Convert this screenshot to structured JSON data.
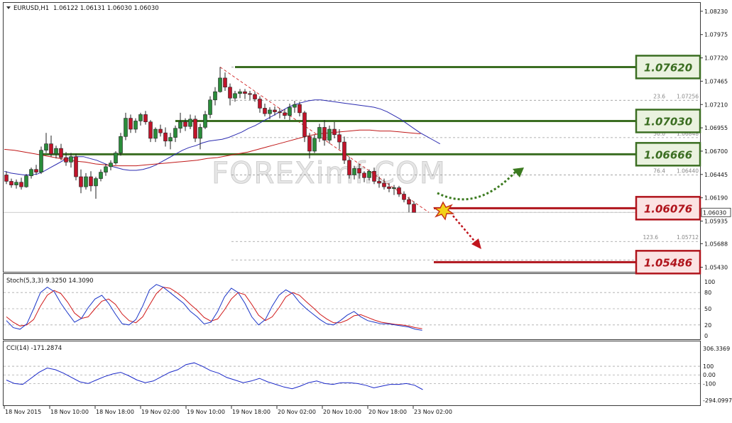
{
  "header": {
    "symbol": "EURUSD,H1",
    "ohlc": "1.06122 1.06131 1.06030 1.06030"
  },
  "watermark": "FOREXimf.COM",
  "price_axis": {
    "ticks": [
      "1.08230",
      "1.07975",
      "1.07720",
      "1.07465",
      "1.07210",
      "1.06955",
      "1.06700",
      "1.06445",
      "1.06190",
      "1.05935",
      "1.05688",
      "1.05430"
    ],
    "current_price": "1.06030"
  },
  "levels": [
    {
      "label": "1.07620",
      "price": 1.0762,
      "color": "#3b6e22",
      "box_bg": "#eaf2df",
      "from_index": 46
    },
    {
      "label": "1.07030",
      "price": 1.0703,
      "color": "#3b6e22",
      "box_bg": "#eaf2df",
      "from_index": 34
    },
    {
      "label": "1.06666",
      "price": 1.06666,
      "color": "#3b6e22",
      "box_bg": "#eaf2df",
      "from_index": 7
    },
    {
      "label": "1.06076",
      "price": 1.06076,
      "color": "#b0141c",
      "box_bg": "#fbe3e3",
      "from_index": 86
    },
    {
      "label": "1.05486",
      "price": 1.05486,
      "color": "#b0141c",
      "box_bg": "#fbe3e3",
      "from_index": 86
    }
  ],
  "fibo": [
    {
      "ratio": "23.6",
      "value": "1.07256",
      "price": 1.07256
    },
    {
      "ratio": "50.0",
      "value": "1.06848",
      "price": 1.06848
    },
    {
      "ratio": "76.4",
      "value": "1.06440",
      "price": 1.0644
    },
    {
      "ratio": "123.6",
      "value": "1.05712",
      "price": 1.05712
    }
  ],
  "stoch": {
    "label": "Stoch(5,3,3) 9.3250 14.3090",
    "ticks": [
      "100",
      "80",
      "50",
      "20",
      "0"
    ]
  },
  "cci": {
    "label": "CCI(14) -171.2874",
    "ticks": [
      "306.3369",
      "100",
      "0.00",
      "-100",
      "-294.0997"
    ]
  },
  "time_axis": {
    "ticks": [
      "18 Nov 2015",
      "18 Nov 10:00",
      "18 Nov 18:00",
      "19 Nov 02:00",
      "19 Nov 10:00",
      "19 Nov 18:00",
      "20 Nov 02:00",
      "20 Nov 10:00",
      "20 Nov 18:00",
      "23 Nov 02:00"
    ]
  },
  "colors": {
    "bull": "#2a8c3a",
    "bear": "#c0142a",
    "ma_fast": "#2b2bb0",
    "ma_slow": "#c01818",
    "stoch_main": "#1a35c8",
    "stoch_signal": "#d01818",
    "cci": "#1a28c8",
    "arrow_up": "#3b7a1f",
    "arrow_down": "#c0141c"
  },
  "chart_data": {
    "type": "candlestick",
    "symbol": "EURUSD",
    "timeframe": "H1",
    "ylim": [
      1.0538,
      1.0826
    ],
    "candles": [
      [
        1.0644,
        1.0648,
        1.0634,
        1.0637
      ],
      [
        1.0637,
        1.064,
        1.063,
        1.0633
      ],
      [
        1.0633,
        1.0639,
        1.0629,
        1.0636
      ],
      [
        1.0636,
        1.0641,
        1.0628,
        1.0631
      ],
      [
        1.0631,
        1.0645,
        1.063,
        1.0643
      ],
      [
        1.0643,
        1.0652,
        1.064,
        1.065
      ],
      [
        1.065,
        1.0655,
        1.0644,
        1.0647
      ],
      [
        1.0647,
        1.0675,
        1.0645,
        1.0671
      ],
      [
        1.0671,
        1.069,
        1.0668,
        1.0678
      ],
      [
        1.0678,
        1.0687,
        1.0664,
        1.0667
      ],
      [
        1.0667,
        1.0676,
        1.0662,
        1.0673
      ],
      [
        1.0673,
        1.0678,
        1.066,
        1.0663
      ],
      [
        1.0663,
        1.0669,
        1.0654,
        1.0658
      ],
      [
        1.0658,
        1.0668,
        1.0652,
        1.0664
      ],
      [
        1.0664,
        1.0667,
        1.0638,
        1.0642
      ],
      [
        1.0642,
        1.065,
        1.0624,
        1.0631
      ],
      [
        1.0631,
        1.0646,
        1.0628,
        1.0642
      ],
      [
        1.0642,
        1.0648,
        1.0626,
        1.0632
      ],
      [
        1.0632,
        1.0642,
        1.0618,
        1.064
      ],
      [
        1.064,
        1.065,
        1.0637,
        1.0647
      ],
      [
        1.0647,
        1.0656,
        1.0643,
        1.0653
      ],
      [
        1.0653,
        1.066,
        1.0649,
        1.0657
      ],
      [
        1.0657,
        1.067,
        1.0655,
        1.0668
      ],
      [
        1.0668,
        1.069,
        1.0665,
        1.0686
      ],
      [
        1.0686,
        1.0712,
        1.0682,
        1.0706
      ],
      [
        1.0706,
        1.071,
        1.069,
        1.0694
      ],
      [
        1.0694,
        1.0706,
        1.069,
        1.0703
      ],
      [
        1.0703,
        1.0712,
        1.0698,
        1.071
      ],
      [
        1.071,
        1.0714,
        1.0699,
        1.0702
      ],
      [
        1.0702,
        1.0704,
        1.068,
        1.0684
      ],
      [
        1.0684,
        1.0696,
        1.068,
        1.0694
      ],
      [
        1.0694,
        1.0699,
        1.0686,
        1.069
      ],
      [
        1.069,
        1.0696,
        1.0675,
        1.0681
      ],
      [
        1.0681,
        1.069,
        1.0672,
        1.0685
      ],
      [
        1.0685,
        1.0698,
        1.068,
        1.0695
      ],
      [
        1.0695,
        1.0712,
        1.069,
        1.0702
      ],
      [
        1.0702,
        1.0706,
        1.0692,
        1.0697
      ],
      [
        1.0697,
        1.071,
        1.0694,
        1.0705
      ],
      [
        1.0705,
        1.0709,
        1.068,
        1.0684
      ],
      [
        1.0684,
        1.07,
        1.0672,
        1.0696
      ],
      [
        1.0696,
        1.0714,
        1.0694,
        1.071
      ],
      [
        1.071,
        1.073,
        1.0706,
        1.0726
      ],
      [
        1.0726,
        1.074,
        1.072,
        1.0735
      ],
      [
        1.0735,
        1.0762,
        1.0734,
        1.075
      ],
      [
        1.075,
        1.0756,
        1.0736,
        1.074
      ],
      [
        1.074,
        1.0744,
        1.072,
        1.0728
      ],
      [
        1.0728,
        1.0736,
        1.0724,
        1.0733
      ],
      [
        1.0733,
        1.0738,
        1.0728,
        1.0735
      ],
      [
        1.0735,
        1.0738,
        1.0727,
        1.0733
      ],
      [
        1.0733,
        1.0736,
        1.0726,
        1.0732
      ],
      [
        1.0732,
        1.0735,
        1.0724,
        1.0727
      ],
      [
        1.0727,
        1.073,
        1.0712,
        1.0717
      ],
      [
        1.0717,
        1.0722,
        1.0708,
        1.0711
      ],
      [
        1.0711,
        1.0718,
        1.0705,
        1.0715
      ],
      [
        1.0715,
        1.0719,
        1.0709,
        1.0713
      ],
      [
        1.0713,
        1.0717,
        1.0706,
        1.0712
      ],
      [
        1.0712,
        1.0716,
        1.0705,
        1.0709
      ],
      [
        1.0709,
        1.0722,
        1.0704,
        1.0718
      ],
      [
        1.0718,
        1.0725,
        1.0712,
        1.0721
      ],
      [
        1.0721,
        1.0724,
        1.0708,
        1.0712
      ],
      [
        1.0712,
        1.0714,
        1.068,
        1.0686
      ],
      [
        1.0686,
        1.069,
        1.0662,
        1.067
      ],
      [
        1.067,
        1.0688,
        1.0668,
        1.0684
      ],
      [
        1.0684,
        1.07,
        1.068,
        1.0696
      ],
      [
        1.0696,
        1.0704,
        1.0676,
        1.0682
      ],
      [
        1.0682,
        1.0698,
        1.0678,
        1.0694
      ],
      [
        1.0694,
        1.0702,
        1.0684,
        1.0688
      ],
      [
        1.0688,
        1.0694,
        1.0672,
        1.068
      ],
      [
        1.068,
        1.0686,
        1.0656,
        1.066
      ],
      [
        1.066,
        1.0664,
        1.064,
        1.0644
      ],
      [
        1.0644,
        1.0654,
        1.0639,
        1.0651
      ],
      [
        1.0651,
        1.0656,
        1.064,
        1.0646
      ],
      [
        1.0646,
        1.0648,
        1.0636,
        1.0641
      ],
      [
        1.0641,
        1.065,
        1.0638,
        1.0648
      ],
      [
        1.0648,
        1.0652,
        1.0634,
        1.0637
      ],
      [
        1.0637,
        1.0642,
        1.063,
        1.0635
      ],
      [
        1.0635,
        1.064,
        1.0628,
        1.0631
      ],
      [
        1.0631,
        1.0635,
        1.0625,
        1.0629
      ],
      [
        1.0629,
        1.0633,
        1.0622,
        1.063
      ],
      [
        1.063,
        1.0632,
        1.062,
        1.0623
      ],
      [
        1.0623,
        1.0626,
        1.0614,
        1.0617
      ],
      [
        1.0617,
        1.062,
        1.0603,
        1.0612
      ],
      [
        1.0612,
        1.0615,
        1.0603,
        1.0603
      ]
    ],
    "ma_fast": [
      1.0648,
      1.0646,
      1.0645,
      1.0644,
      1.0644,
      1.0645,
      1.0648,
      1.0652,
      1.0656,
      1.066,
      1.0663,
      1.0664,
      1.0664,
      1.0662,
      1.066,
      1.0657,
      1.0654,
      1.0652,
      1.065,
      1.0649,
      1.0649,
      1.065,
      1.0652,
      1.0655,
      1.0659,
      1.0663,
      1.0667,
      1.0671,
      1.0674,
      1.0676,
      1.0679,
      1.0681,
      1.0682,
      1.0683,
      1.0685,
      1.0688,
      1.0691,
      1.0695,
      1.0698,
      1.0702,
      1.0706,
      1.071,
      1.0714,
      1.0718,
      1.0721,
      1.0723,
      1.0725,
      1.0726,
      1.0726,
      1.0725,
      1.0724,
      1.0723,
      1.0722,
      1.0721,
      1.072,
      1.0719,
      1.0718,
      1.0716,
      1.0713,
      1.0709,
      1.0705,
      1.07,
      1.0695,
      1.069,
      1.0686,
      1.0682,
      1.0678
    ],
    "ma_slow": [
      1.0672,
      1.0671,
      1.0669,
      1.0667,
      1.0665,
      1.0663,
      1.0661,
      1.0659,
      1.0658,
      1.0656,
      1.0655,
      1.0654,
      1.0654,
      1.0654,
      1.0655,
      1.0656,
      1.0657,
      1.0658,
      1.0659,
      1.066,
      1.0662,
      1.0663,
      1.0665,
      1.0667,
      1.0669,
      1.0672,
      1.0675,
      1.0678,
      1.0681,
      1.0684,
      1.0687,
      1.0689,
      1.069,
      1.0691,
      1.0692,
      1.0693,
      1.0693,
      1.0692,
      1.0692,
      1.0691,
      1.069,
      1.0689
    ],
    "stoch_main": [
      28,
      15,
      12,
      22,
      50,
      80,
      90,
      82,
      60,
      42,
      25,
      32,
      52,
      68,
      75,
      60,
      40,
      22,
      20,
      30,
      55,
      85,
      95,
      90,
      80,
      70,
      60,
      45,
      35,
      22,
      25,
      45,
      72,
      88,
      80,
      60,
      35,
      20,
      30,
      55,
      75,
      85,
      78,
      62,
      50,
      40,
      30,
      22,
      20,
      28,
      38,
      45,
      35,
      28,
      25,
      22,
      22,
      20,
      18,
      16,
      12,
      10
    ],
    "stoch_signal": [
      35,
      25,
      18,
      20,
      30,
      55,
      75,
      84,
      78,
      62,
      42,
      32,
      35,
      50,
      64,
      68,
      58,
      40,
      28,
      24,
      35,
      57,
      78,
      90,
      88,
      80,
      70,
      58,
      47,
      34,
      27,
      31,
      48,
      68,
      80,
      76,
      58,
      38,
      28,
      35,
      52,
      72,
      80,
      75,
      63,
      52,
      40,
      31,
      24,
      24,
      29,
      37,
      39,
      34,
      29,
      25,
      23,
      21,
      20,
      18,
      15,
      13
    ],
    "cci": [
      -60,
      -100,
      -110,
      -40,
      30,
      80,
      60,
      20,
      -30,
      -80,
      -100,
      -60,
      -20,
      10,
      30,
      -10,
      -60,
      -90,
      -70,
      -20,
      30,
      60,
      120,
      140,
      100,
      50,
      20,
      -30,
      -60,
      -90,
      -70,
      -40,
      -80,
      -110,
      -140,
      -160,
      -130,
      -90,
      -70,
      -100,
      -110,
      -90,
      -90,
      -100,
      -120,
      -150,
      -130,
      -110,
      -110,
      -100,
      -120,
      -171
    ]
  }
}
